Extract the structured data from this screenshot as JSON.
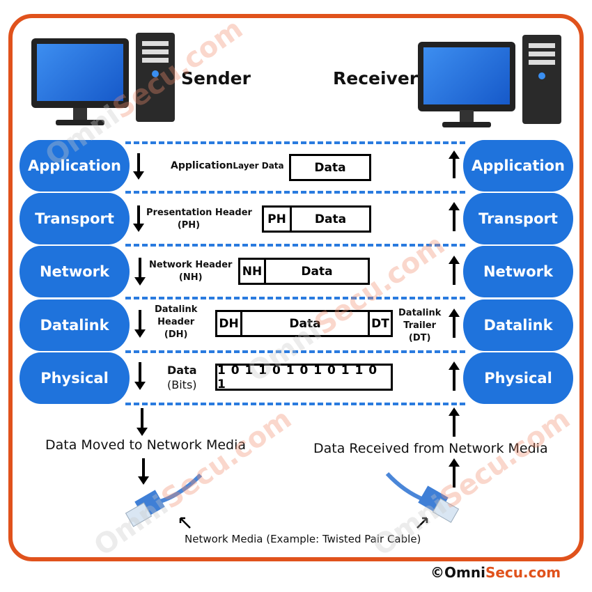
{
  "sender": {
    "title": "Sender"
  },
  "receiver": {
    "title": "Receiver"
  },
  "layers": [
    "Application",
    "Transport",
    "Network",
    "Datalink",
    "Physical"
  ],
  "encapsulation": {
    "application": {
      "label_a": "Application",
      "label_b": "Layer Data",
      "data": "Data"
    },
    "transport": {
      "label_line1": "Presentation Header",
      "label_line2": "(PH)",
      "header": "PH",
      "data": "Data"
    },
    "network": {
      "label_line1": "Network Header",
      "label_line2": "(NH)",
      "header": "NH",
      "data": "Data"
    },
    "datalink": {
      "label_line1": "Datalink",
      "label_line2": "Header",
      "label_line3": "(DH)",
      "header": "DH",
      "data": "Data",
      "trailer": "DT",
      "trailer_line1": "Datalink",
      "trailer_line2": "Trailer",
      "trailer_line3": "(DT)"
    },
    "physical": {
      "label_line1": "Data",
      "label_line2": "(Bits)",
      "bits": "1 0 1 1 0 1 0 1 0 1 1 0 1"
    }
  },
  "media": {
    "sent": "Data Moved to Network Media",
    "received": "Data Received from Network Media",
    "caption": "Network Media (Example: Twisted Pair Cable)"
  },
  "brand": {
    "copyright": "©",
    "name_a": "Omni",
    "name_b": "Secu",
    "name_c": ".com",
    "watermark": "OmniSecu.com"
  },
  "colors": {
    "frame": "#e0521c",
    "layer": "#1f73dc",
    "brand_orange": "#e0521c"
  }
}
